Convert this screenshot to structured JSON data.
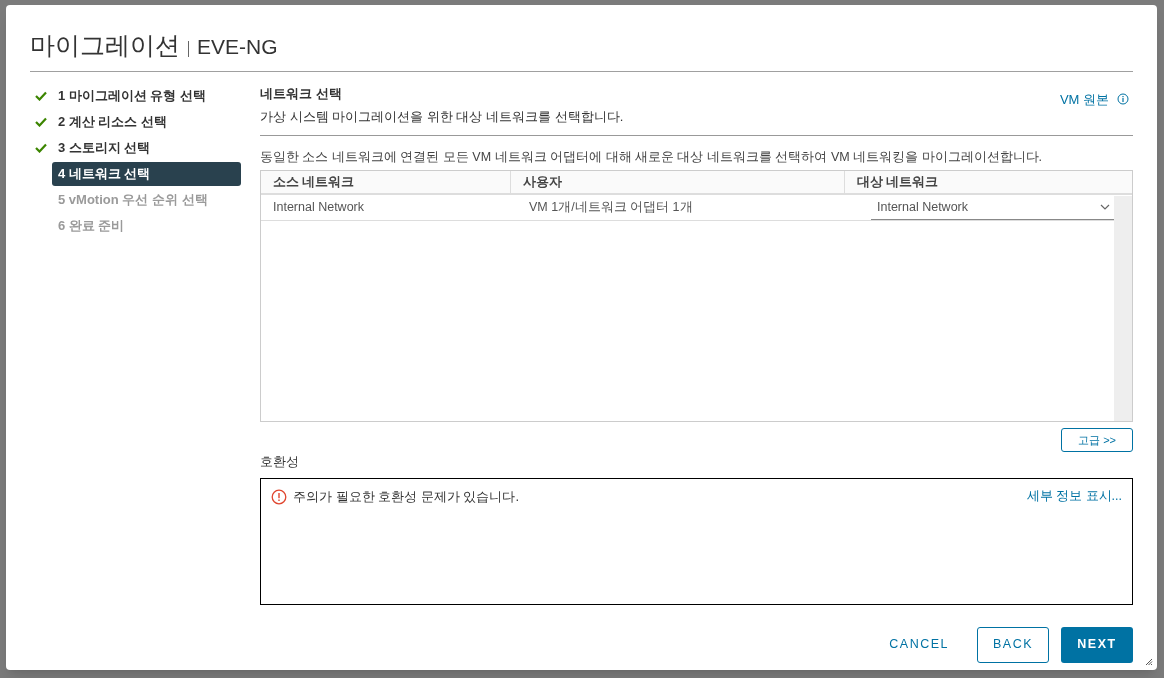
{
  "dialog": {
    "title": "마이그레이션",
    "subtitle": "EVE-NG"
  },
  "steps": [
    {
      "label": "1 마이그레이션 유형 선택",
      "completed": true,
      "disabled": false,
      "selected": false
    },
    {
      "label": "2 계산 리소스 선택",
      "completed": true,
      "disabled": false,
      "selected": false
    },
    {
      "label": "3 스토리지 선택",
      "completed": true,
      "disabled": false,
      "selected": false
    },
    {
      "label": "4 네트워크 선택",
      "completed": false,
      "disabled": false,
      "selected": true
    },
    {
      "label": "5 vMotion 우선 순위 선택",
      "completed": false,
      "disabled": true,
      "selected": false
    },
    {
      "label": "6 완료 준비",
      "completed": false,
      "disabled": true,
      "selected": false
    }
  ],
  "section": {
    "title": "네트워크 선택",
    "subtitle": "가상 시스템 마이그레이션을 위한 대상 네트워크를 선택합니다.",
    "link": "VM 원본"
  },
  "instruction": "동일한 소스 네트워크에 연결된 모든 VM 네트워크 어댑터에 대해 새로운 대상 네트워크를 선택하여 VM 네트워킹을 마이그레이션합니다.",
  "table": {
    "columns": [
      "소스 네트워크",
      "사용자",
      "대상 네트워크"
    ],
    "rows": [
      {
        "source": "Internal Network",
        "users": "VM 1개/네트워크 어댑터 1개",
        "target": "Internal Network"
      }
    ]
  },
  "advanced_button": "고급 >>",
  "compatibility": {
    "label": "호환성",
    "message": "주의가 필요한 호환성 문제가 있습니다.",
    "link": "세부 정보 표시..."
  },
  "buttons": {
    "cancel": "CANCEL",
    "back": "BACK",
    "next": "NEXT"
  }
}
